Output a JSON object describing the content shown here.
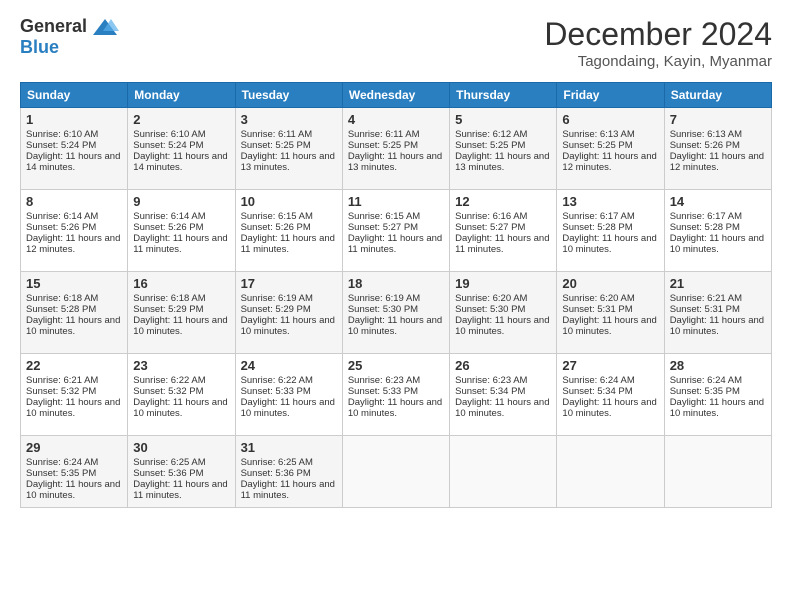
{
  "header": {
    "logo_general": "General",
    "logo_blue": "Blue",
    "month_title": "December 2024",
    "location": "Tagondaing, Kayin, Myanmar"
  },
  "days_of_week": [
    "Sunday",
    "Monday",
    "Tuesday",
    "Wednesday",
    "Thursday",
    "Friday",
    "Saturday"
  ],
  "weeks": [
    [
      {
        "day": 1,
        "sunrise": "6:10 AM",
        "sunset": "5:24 PM",
        "daylight": "11 hours and 14 minutes"
      },
      {
        "day": 2,
        "sunrise": "6:10 AM",
        "sunset": "5:24 PM",
        "daylight": "11 hours and 14 minutes"
      },
      {
        "day": 3,
        "sunrise": "6:11 AM",
        "sunset": "5:25 PM",
        "daylight": "11 hours and 13 minutes"
      },
      {
        "day": 4,
        "sunrise": "6:11 AM",
        "sunset": "5:25 PM",
        "daylight": "11 hours and 13 minutes"
      },
      {
        "day": 5,
        "sunrise": "6:12 AM",
        "sunset": "5:25 PM",
        "daylight": "11 hours and 13 minutes"
      },
      {
        "day": 6,
        "sunrise": "6:13 AM",
        "sunset": "5:25 PM",
        "daylight": "11 hours and 12 minutes"
      },
      {
        "day": 7,
        "sunrise": "6:13 AM",
        "sunset": "5:26 PM",
        "daylight": "11 hours and 12 minutes"
      }
    ],
    [
      {
        "day": 8,
        "sunrise": "6:14 AM",
        "sunset": "5:26 PM",
        "daylight": "11 hours and 12 minutes"
      },
      {
        "day": 9,
        "sunrise": "6:14 AM",
        "sunset": "5:26 PM",
        "daylight": "11 hours and 11 minutes"
      },
      {
        "day": 10,
        "sunrise": "6:15 AM",
        "sunset": "5:26 PM",
        "daylight": "11 hours and 11 minutes"
      },
      {
        "day": 11,
        "sunrise": "6:15 AM",
        "sunset": "5:27 PM",
        "daylight": "11 hours and 11 minutes"
      },
      {
        "day": 12,
        "sunrise": "6:16 AM",
        "sunset": "5:27 PM",
        "daylight": "11 hours and 11 minutes"
      },
      {
        "day": 13,
        "sunrise": "6:17 AM",
        "sunset": "5:28 PM",
        "daylight": "11 hours and 10 minutes"
      },
      {
        "day": 14,
        "sunrise": "6:17 AM",
        "sunset": "5:28 PM",
        "daylight": "11 hours and 10 minutes"
      }
    ],
    [
      {
        "day": 15,
        "sunrise": "6:18 AM",
        "sunset": "5:28 PM",
        "daylight": "11 hours and 10 minutes"
      },
      {
        "day": 16,
        "sunrise": "6:18 AM",
        "sunset": "5:29 PM",
        "daylight": "11 hours and 10 minutes"
      },
      {
        "day": 17,
        "sunrise": "6:19 AM",
        "sunset": "5:29 PM",
        "daylight": "11 hours and 10 minutes"
      },
      {
        "day": 18,
        "sunrise": "6:19 AM",
        "sunset": "5:30 PM",
        "daylight": "11 hours and 10 minutes"
      },
      {
        "day": 19,
        "sunrise": "6:20 AM",
        "sunset": "5:30 PM",
        "daylight": "11 hours and 10 minutes"
      },
      {
        "day": 20,
        "sunrise": "6:20 AM",
        "sunset": "5:31 PM",
        "daylight": "11 hours and 10 minutes"
      },
      {
        "day": 21,
        "sunrise": "6:21 AM",
        "sunset": "5:31 PM",
        "daylight": "11 hours and 10 minutes"
      }
    ],
    [
      {
        "day": 22,
        "sunrise": "6:21 AM",
        "sunset": "5:32 PM",
        "daylight": "11 hours and 10 minutes"
      },
      {
        "day": 23,
        "sunrise": "6:22 AM",
        "sunset": "5:32 PM",
        "daylight": "11 hours and 10 minutes"
      },
      {
        "day": 24,
        "sunrise": "6:22 AM",
        "sunset": "5:33 PM",
        "daylight": "11 hours and 10 minutes"
      },
      {
        "day": 25,
        "sunrise": "6:23 AM",
        "sunset": "5:33 PM",
        "daylight": "11 hours and 10 minutes"
      },
      {
        "day": 26,
        "sunrise": "6:23 AM",
        "sunset": "5:34 PM",
        "daylight": "11 hours and 10 minutes"
      },
      {
        "day": 27,
        "sunrise": "6:24 AM",
        "sunset": "5:34 PM",
        "daylight": "11 hours and 10 minutes"
      },
      {
        "day": 28,
        "sunrise": "6:24 AM",
        "sunset": "5:35 PM",
        "daylight": "11 hours and 10 minutes"
      }
    ],
    [
      {
        "day": 29,
        "sunrise": "6:24 AM",
        "sunset": "5:35 PM",
        "daylight": "11 hours and 10 minutes"
      },
      {
        "day": 30,
        "sunrise": "6:25 AM",
        "sunset": "5:36 PM",
        "daylight": "11 hours and 11 minutes"
      },
      {
        "day": 31,
        "sunrise": "6:25 AM",
        "sunset": "5:36 PM",
        "daylight": "11 hours and 11 minutes"
      },
      null,
      null,
      null,
      null
    ]
  ]
}
